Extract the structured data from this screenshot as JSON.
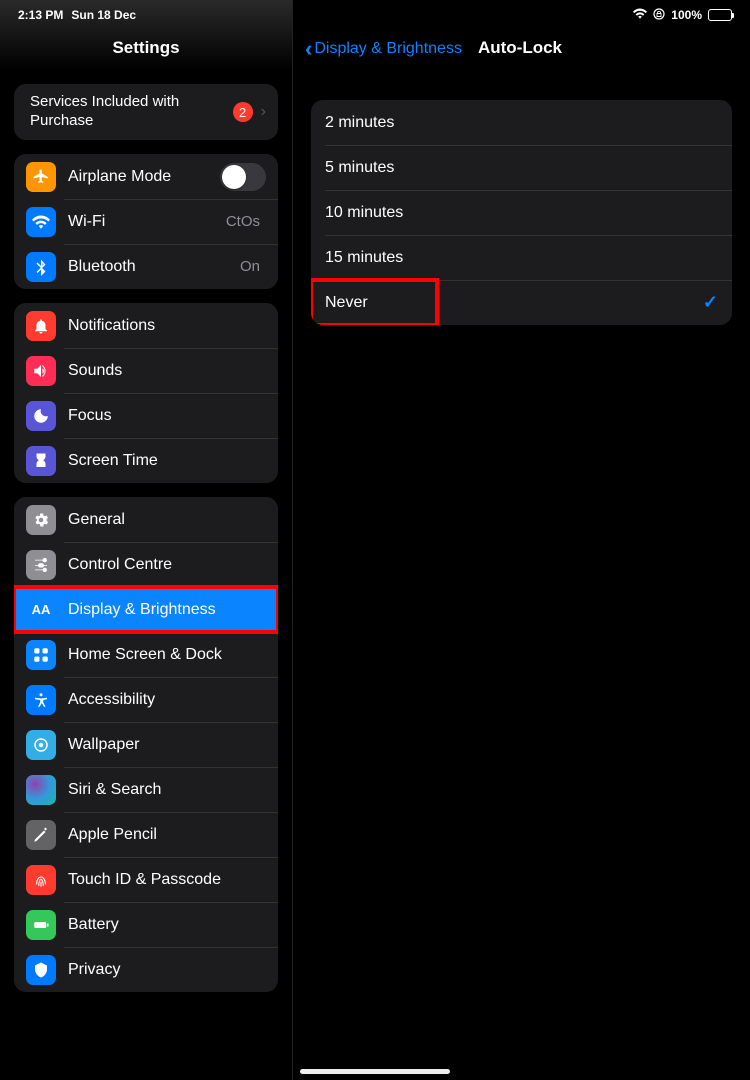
{
  "status": {
    "time": "2:13 PM",
    "date": "Sun 18 Dec",
    "battery_pct": "100%"
  },
  "sidebar": {
    "title": "Settings",
    "services": {
      "label": "Services Included with Purchase",
      "badge": "2"
    },
    "airplane": {
      "label": "Airplane Mode"
    },
    "wifi": {
      "label": "Wi-Fi",
      "value": "CtOs"
    },
    "bluetooth": {
      "label": "Bluetooth",
      "value": "On"
    },
    "notifications": {
      "label": "Notifications"
    },
    "sounds": {
      "label": "Sounds"
    },
    "focus": {
      "label": "Focus"
    },
    "screentime": {
      "label": "Screen Time"
    },
    "general": {
      "label": "General"
    },
    "control": {
      "label": "Control Centre"
    },
    "display": {
      "label": "Display & Brightness"
    },
    "homescreen": {
      "label": "Home Screen & Dock"
    },
    "accessibility": {
      "label": "Accessibility"
    },
    "wallpaper": {
      "label": "Wallpaper"
    },
    "siri": {
      "label": "Siri & Search"
    },
    "pencil": {
      "label": "Apple Pencil"
    },
    "touchid": {
      "label": "Touch ID & Passcode"
    },
    "battery": {
      "label": "Battery"
    },
    "privacy": {
      "label": "Privacy"
    }
  },
  "nav": {
    "back": "Display & Brightness",
    "title": "Auto-Lock"
  },
  "options": {
    "o1": "2 minutes",
    "o2": "5 minutes",
    "o3": "10 minutes",
    "o4": "15 minutes",
    "o5": "Never"
  }
}
